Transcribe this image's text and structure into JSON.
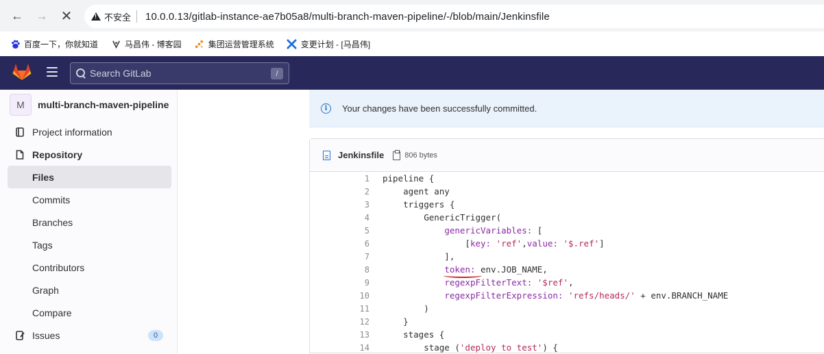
{
  "browser": {
    "security_label": "不安全",
    "url": "10.0.0.13/gitlab-instance-ae7b05a8/multi-branch-maven-pipeline/-/blob/main/Jenkinsfile",
    "bookmarks": [
      {
        "label": "百度一下，你就知道",
        "icon": "baidu-paw-icon"
      },
      {
        "label": "马昌伟 - 博客园",
        "icon": "cnblogs-icon"
      },
      {
        "label": "集团运营管理系统",
        "icon": "dots-logo-icon"
      },
      {
        "label": "变更计划 - [马昌伟]",
        "icon": "x-logo-icon"
      }
    ]
  },
  "header": {
    "search_placeholder": "Search GitLab",
    "search_shortcut": "/"
  },
  "sidebar": {
    "project_initial": "M",
    "project_name": "multi-branch-maven-pipeline",
    "items": [
      {
        "label": "Project information",
        "icon": "book-icon"
      },
      {
        "label": "Repository",
        "icon": "doc-icon"
      },
      {
        "label": "Files"
      },
      {
        "label": "Commits"
      },
      {
        "label": "Branches"
      },
      {
        "label": "Tags"
      },
      {
        "label": "Contributors"
      },
      {
        "label": "Graph"
      },
      {
        "label": "Compare"
      },
      {
        "label": "Issues",
        "icon": "issues-icon",
        "badge": "0"
      }
    ]
  },
  "alert": {
    "message": "Your changes have been successfully committed."
  },
  "file": {
    "name": "Jenkinsfile",
    "size": "806 bytes"
  },
  "code": {
    "line_numbers": [
      "1",
      "2",
      "3",
      "4",
      "5",
      "6",
      "7",
      "8",
      "9",
      "10",
      "11",
      "12",
      "13",
      "14"
    ]
  },
  "colors": {
    "header_bg": "#28285a",
    "alert_bg": "#eaf2fb",
    "keyword": "#8a2aa5",
    "string": "#b42a5c",
    "annotation_underline": "#d32020"
  }
}
